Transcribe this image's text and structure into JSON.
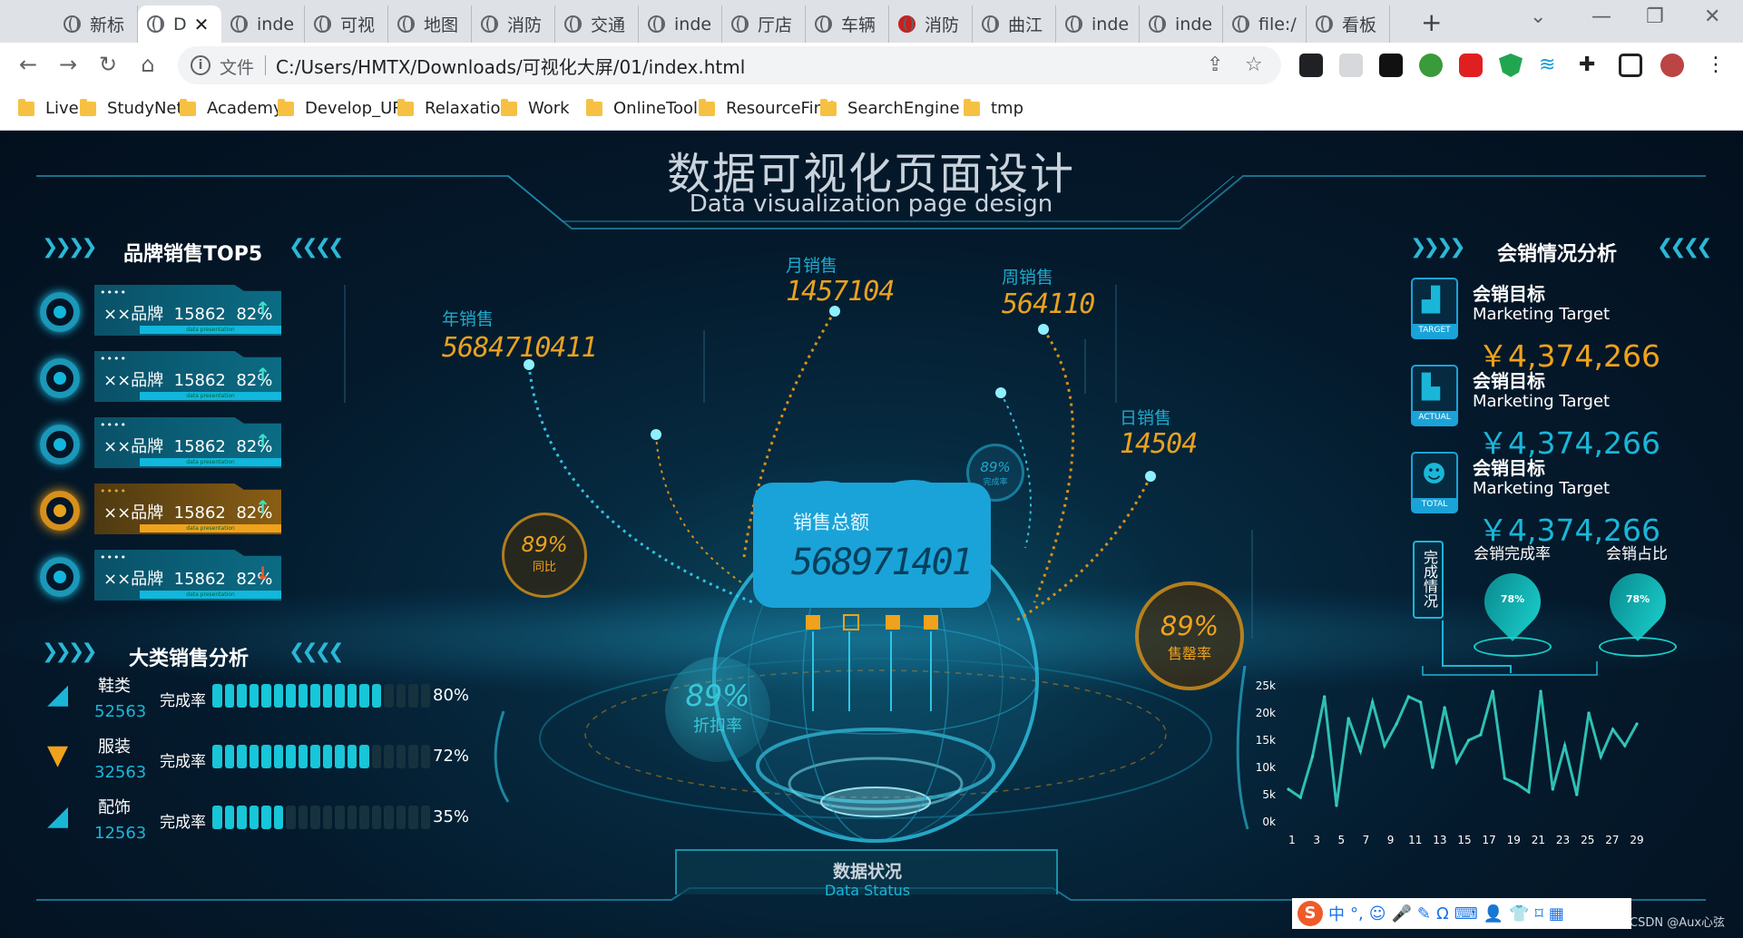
{
  "browser": {
    "tabs": [
      {
        "label": "新标"
      },
      {
        "label": "D",
        "active": true
      },
      {
        "label": "inde"
      },
      {
        "label": "可视"
      },
      {
        "label": "地图"
      },
      {
        "label": "消防"
      },
      {
        "label": "交通"
      },
      {
        "label": "inde"
      },
      {
        "label": "厅店"
      },
      {
        "label": "车辆"
      },
      {
        "label": "消防",
        "fire": true
      },
      {
        "label": "曲江"
      },
      {
        "label": "inde"
      },
      {
        "label": "inde"
      },
      {
        "label": "file:/"
      },
      {
        "label": "看板"
      }
    ],
    "address": {
      "protocol_label": "文件",
      "url": "C:/Users/HMTX/Downloads/可视化大屏/01/index.html"
    },
    "bookmarks": [
      "Live",
      "StudyNet",
      "Academy",
      "Develop_URL",
      "Relaxation",
      "Work",
      "OnlineTools",
      "ResourceFind",
      "SearchEngine",
      "tmp"
    ]
  },
  "dashboard": {
    "title": "数据可视化页面设计",
    "subtitle": "Data visualization page design",
    "brand_section": {
      "title": "品牌销售TOP5",
      "rows": [
        {
          "label": "××品牌",
          "value": "15862",
          "pct": "82%",
          "trend": "up",
          "strip": "data presentation"
        },
        {
          "label": "××品牌",
          "value": "15862",
          "pct": "82%",
          "trend": "up",
          "strip": "data presentation"
        },
        {
          "label": "××品牌",
          "value": "15862",
          "pct": "82%",
          "trend": "up",
          "strip": "data presentation"
        },
        {
          "label": "××品牌",
          "value": "15862",
          "pct": "82%",
          "trend": "up",
          "highlight": true,
          "strip": "data presentation"
        },
        {
          "label": "××品牌",
          "value": "15862",
          "pct": "82%",
          "trend": "down",
          "strip": "data presentation"
        }
      ]
    },
    "category_section": {
      "title": "大类销售分析",
      "rate_label": "完成率",
      "rows": [
        {
          "name": "鞋类",
          "value": "52563",
          "pct": "80%",
          "fill": 0.8,
          "icon": "shoe-icon"
        },
        {
          "name": "服装",
          "value": "32563",
          "pct": "72%",
          "fill": 0.72,
          "icon": "shirt-icon"
        },
        {
          "name": "配饰",
          "value": "12563",
          "pct": "35%",
          "fill": 0.35,
          "icon": "accessory-icon"
        }
      ]
    },
    "center": {
      "year": {
        "label": "年销售",
        "value": "5684710411"
      },
      "month": {
        "label": "月销售",
        "value": "1457104"
      },
      "week": {
        "label": "周销售",
        "value": "564110"
      },
      "day": {
        "label": "日销售",
        "value": "14504"
      },
      "total": {
        "label": "销售总额",
        "value": "568971401"
      },
      "yoy": {
        "pct": "89%",
        "label": "同比"
      },
      "small": {
        "pct": "89%",
        "label": "完成率"
      },
      "discount": {
        "pct": "89%",
        "label": "折扣率"
      },
      "sellout": {
        "pct": "89%",
        "label": "售罄率"
      },
      "status": {
        "title": "数据状况",
        "subtitle": "Data Status"
      }
    },
    "marketing": {
      "title": "会销情况分析",
      "items": [
        {
          "title": "会销目标",
          "subtitle": "Marketing Target",
          "value": "￥4,374,266",
          "badge": "TARGET",
          "color": "#f0a21c",
          "icon": "target-chart-icon"
        },
        {
          "title": "会销目标",
          "subtitle": "Marketing Target",
          "value": "￥4,374,266",
          "badge": "ACTUAL",
          "color": "#1ab6d8",
          "icon": "actual-chart-icon"
        },
        {
          "title": "会销目标",
          "subtitle": "Marketing Target",
          "value": "￥4,374,266",
          "badge": "TOTAL",
          "color": "#1ab6d8",
          "icon": "person-icon"
        }
      ],
      "status_label": "完成情况",
      "gauges": [
        {
          "label": "会销完成率",
          "pct": "78%"
        },
        {
          "label": "会销占比",
          "pct": "78%"
        }
      ]
    },
    "chart_data": {
      "type": "line",
      "x": [
        "1",
        "3",
        "5",
        "7",
        "9",
        "11",
        "13",
        "15",
        "17",
        "19",
        "21",
        "23",
        "25",
        "27",
        "29"
      ],
      "y_ticks": [
        "25k",
        "20k",
        "15k",
        "10k",
        "5k",
        "0k"
      ],
      "ylim": [
        0,
        25000
      ],
      "values": [
        6000,
        4500,
        12000,
        23000,
        3000,
        19000,
        13000,
        22000,
        14000,
        18000,
        23000,
        22000,
        10000,
        21000,
        11000,
        15000,
        16000,
        24000,
        8000,
        7000,
        5500,
        24000,
        6000,
        14000,
        5000,
        20000,
        12000,
        17000,
        14000,
        18000
      ]
    },
    "watermark": "CSDN @Aux心弦",
    "ime": [
      "中",
      "°,",
      "☺",
      "🎤",
      "✎",
      "Ω",
      "⌨",
      "👤",
      "👕",
      "⌑",
      "▦"
    ]
  },
  "colors": {
    "accent": "#1ab6d8",
    "gold": "#f0a21c",
    "bg": "#041526"
  }
}
